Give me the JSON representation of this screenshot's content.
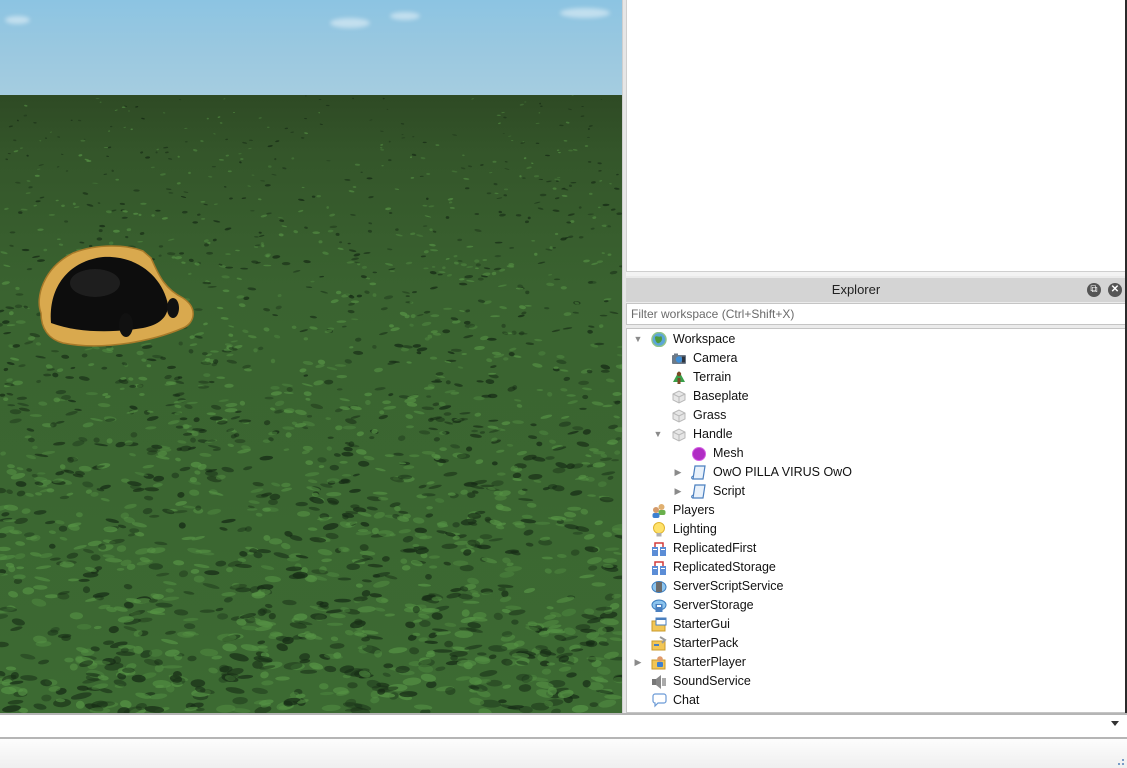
{
  "explorer": {
    "title": "Explorer",
    "float_button_icon": "float-window-icon",
    "close_button_icon": "close-icon",
    "filter_placeholder": "Filter workspace (Ctrl+Shift+X)",
    "filter_value": "",
    "tree": [
      {
        "label": "Workspace",
        "depth": 0,
        "expander": "expanded",
        "icon": "workspace-icon"
      },
      {
        "label": "Camera",
        "depth": 1,
        "expander": "none",
        "icon": "camera-icon"
      },
      {
        "label": "Terrain",
        "depth": 1,
        "expander": "none",
        "icon": "terrain-icon"
      },
      {
        "label": "Baseplate",
        "depth": 1,
        "expander": "none",
        "icon": "part-icon"
      },
      {
        "label": "Grass",
        "depth": 1,
        "expander": "none",
        "icon": "part-icon"
      },
      {
        "label": "Handle",
        "depth": 1,
        "expander": "expanded",
        "icon": "part-icon"
      },
      {
        "label": "Mesh",
        "depth": 2,
        "expander": "none",
        "icon": "mesh-icon"
      },
      {
        "label": "OwO PILLA VIRUS OwO",
        "depth": 2,
        "expander": "collapsed",
        "icon": "script-icon"
      },
      {
        "label": "Script",
        "depth": 2,
        "expander": "collapsed",
        "icon": "script-icon"
      },
      {
        "label": "Players",
        "depth": 0,
        "expander": "none",
        "icon": "players-icon"
      },
      {
        "label": "Lighting",
        "depth": 0,
        "expander": "none",
        "icon": "lighting-icon"
      },
      {
        "label": "ReplicatedFirst",
        "depth": 0,
        "expander": "none",
        "icon": "replicated-icon"
      },
      {
        "label": "ReplicatedStorage",
        "depth": 0,
        "expander": "none",
        "icon": "replicated-icon"
      },
      {
        "label": "ServerScriptService",
        "depth": 0,
        "expander": "none",
        "icon": "server-script-service-icon"
      },
      {
        "label": "ServerStorage",
        "depth": 0,
        "expander": "none",
        "icon": "server-storage-icon"
      },
      {
        "label": "StarterGui",
        "depth": 0,
        "expander": "none",
        "icon": "starter-gui-icon"
      },
      {
        "label": "StarterPack",
        "depth": 0,
        "expander": "none",
        "icon": "starter-pack-icon"
      },
      {
        "label": "StarterPlayer",
        "depth": 0,
        "expander": "collapsed",
        "icon": "starter-player-icon"
      },
      {
        "label": "SoundService",
        "depth": 0,
        "expander": "none",
        "icon": "sound-service-icon"
      },
      {
        "label": "Chat",
        "depth": 0,
        "expander": "none",
        "icon": "chat-icon"
      }
    ]
  },
  "command_bar": {
    "value": "",
    "dropdown_icon": "chevron-down-icon"
  },
  "colors": {
    "sky": "#9ac8e0",
    "grass": "#3a6330",
    "hat_body": "#0a0a0a",
    "hat_brim": "#d9a94e",
    "panel_header": "#d4d4d4"
  }
}
